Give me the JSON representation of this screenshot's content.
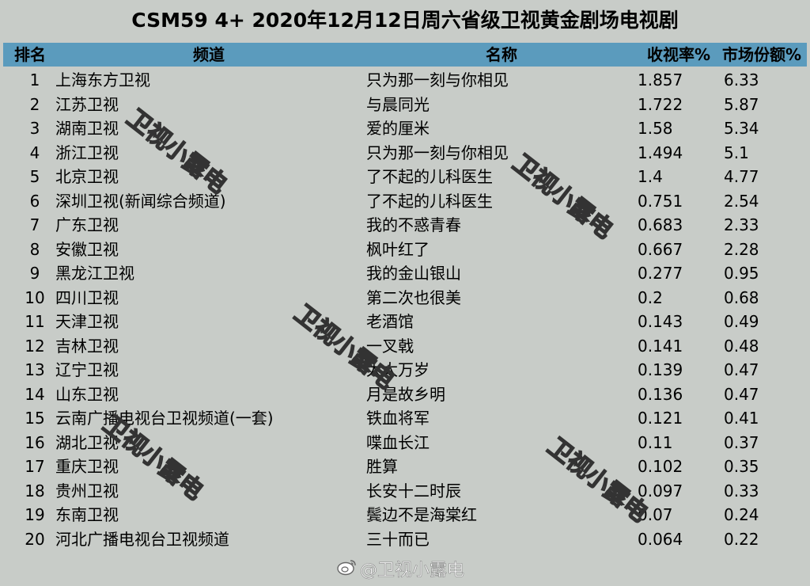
{
  "title": "CSM59 4+ 2020年12月12日周六省级卫视黄金剧场电视剧",
  "headers": {
    "rank": "排名",
    "channel": "频道",
    "name": "名称",
    "rating": "收视率%",
    "share": "市场份额%"
  },
  "rows": [
    {
      "rank": "1",
      "channel": "上海东方卫视",
      "name": "只为那一刻与你相见",
      "rating": "1.857",
      "share": "6.33"
    },
    {
      "rank": "2",
      "channel": "江苏卫视",
      "name": "与晨同光",
      "rating": "1.722",
      "share": "5.87"
    },
    {
      "rank": "3",
      "channel": "湖南卫视",
      "name": "爱的厘米",
      "rating": "1.58",
      "share": "5.34"
    },
    {
      "rank": "4",
      "channel": "浙江卫视",
      "name": "只为那一刻与你相见",
      "rating": "1.494",
      "share": "5.1"
    },
    {
      "rank": "5",
      "channel": "北京卫视",
      "name": "了不起的儿科医生",
      "rating": "1.4",
      "share": "4.77"
    },
    {
      "rank": "6",
      "channel": "深圳卫视(新闻综合频道)",
      "name": "了不起的儿科医生",
      "rating": "0.751",
      "share": "2.54"
    },
    {
      "rank": "7",
      "channel": "广东卫视",
      "name": "我的不惑青春",
      "rating": "0.683",
      "share": "2.33"
    },
    {
      "rank": "8",
      "channel": "安徽卫视",
      "name": "枫叶红了",
      "rating": "0.667",
      "share": "2.28"
    },
    {
      "rank": "9",
      "channel": "黑龙江卫视",
      "name": "我的金山银山",
      "rating": "0.277",
      "share": "0.95"
    },
    {
      "rank": "10",
      "channel": "四川卫视",
      "name": "第二次也很美",
      "rating": "0.2",
      "share": "0.68"
    },
    {
      "rank": "11",
      "channel": "天津卫视",
      "name": "老酒馆",
      "rating": "0.143",
      "share": "0.49"
    },
    {
      "rank": "12",
      "channel": "吉林卫视",
      "name": "一叉戟",
      "rating": "0.141",
      "share": "0.48"
    },
    {
      "rank": "13",
      "channel": "辽宁卫视",
      "name": "太太万岁",
      "rating": "0.139",
      "share": "0.47"
    },
    {
      "rank": "14",
      "channel": "山东卫视",
      "name": "月是故乡明",
      "rating": "0.136",
      "share": "0.47"
    },
    {
      "rank": "15",
      "channel": "云南广播电视台卫视频道(一套)",
      "name": "铁血将军",
      "rating": "0.121",
      "share": "0.41"
    },
    {
      "rank": "16",
      "channel": "湖北卫视",
      "name": "喋血长江",
      "rating": "0.11",
      "share": "0.37"
    },
    {
      "rank": "17",
      "channel": "重庆卫视",
      "name": "胜算",
      "rating": "0.102",
      "share": "0.35"
    },
    {
      "rank": "18",
      "channel": "贵州卫视",
      "name": "长安十二时辰",
      "rating": "0.097",
      "share": "0.33"
    },
    {
      "rank": "19",
      "channel": "东南卫视",
      "name": "鬓边不是海棠红",
      "rating": "0.07",
      "share": "0.24"
    },
    {
      "rank": "20",
      "channel": "河北广播电视台卫视频道",
      "name": "三十而已",
      "rating": "0.064",
      "share": "0.22"
    }
  ],
  "watermark": "卫视小露电",
  "footer_watermark": "@卫视小露电",
  "colors": {
    "background": "#c8ccc8",
    "header_bg": "#5b9bbd"
  }
}
